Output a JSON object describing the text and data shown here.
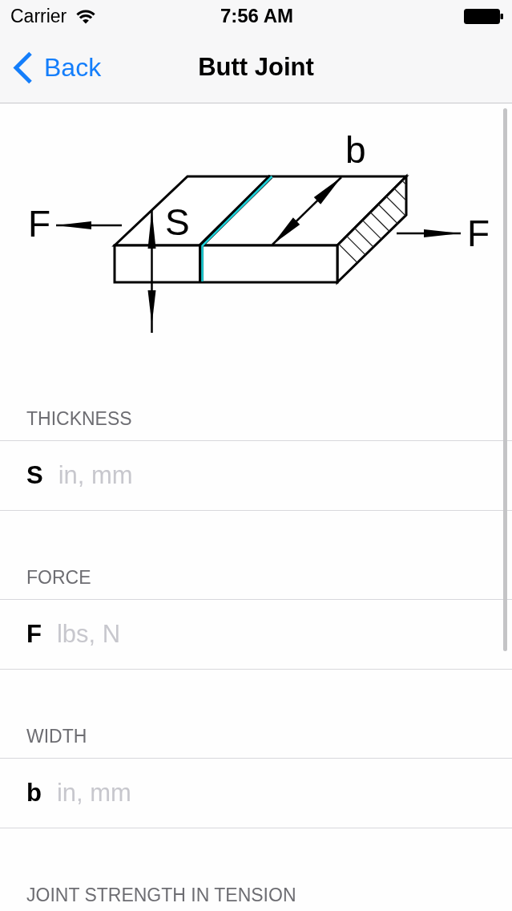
{
  "status_bar": {
    "carrier": "Carrier",
    "time": "7:56 AM"
  },
  "nav_bar": {
    "back": "Back",
    "title": "Butt Joint"
  },
  "diagram": {
    "forces": [
      {
        "label": "F"
      },
      {
        "label": "F"
      }
    ],
    "thickness": {
      "label": "S"
    },
    "width": {
      "label": "b"
    }
  },
  "sections": [
    {
      "header": "THICKNESS",
      "field": {
        "symbol": "S",
        "placeholder": "in, mm"
      }
    },
    {
      "header": "FORCE",
      "field": {
        "symbol": "F",
        "placeholder": "lbs, N"
      }
    },
    {
      "header": "WIDTH",
      "field": {
        "symbol": "b",
        "placeholder": "in, mm"
      }
    },
    {
      "header": "JOINT STRENGTH IN TENSION"
    }
  ]
}
